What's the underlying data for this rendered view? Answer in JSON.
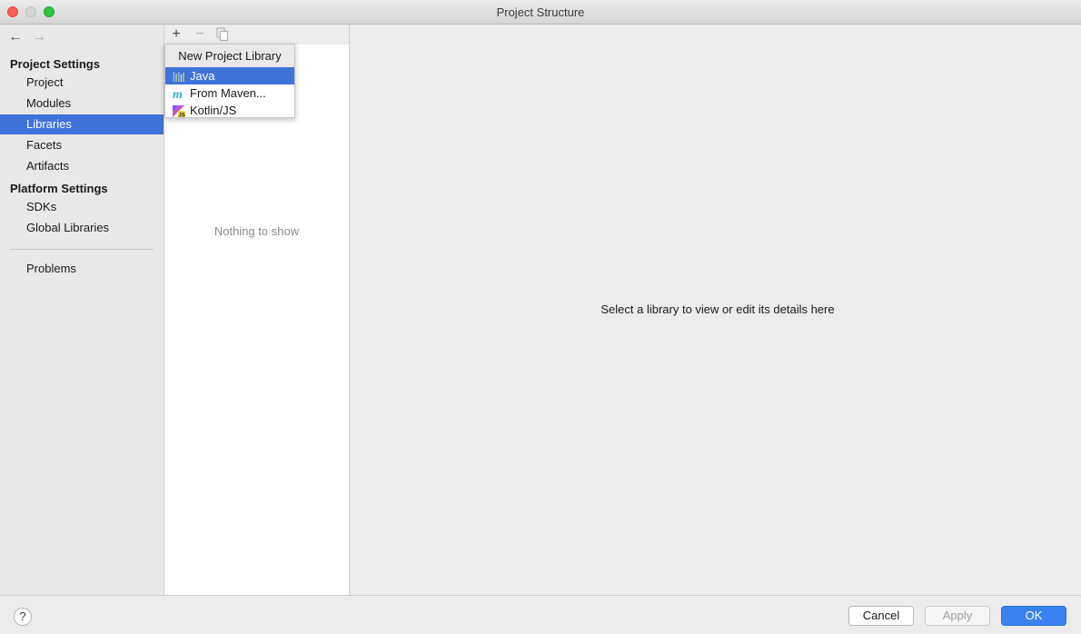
{
  "window": {
    "title": "Project Structure"
  },
  "sidebar": {
    "project_settings_title": "Project Settings",
    "project_items": [
      {
        "label": "Project"
      },
      {
        "label": "Modules"
      },
      {
        "label": "Libraries",
        "selected": true
      },
      {
        "label": "Facets"
      },
      {
        "label": "Artifacts"
      }
    ],
    "platform_settings_title": "Platform Settings",
    "platform_items": [
      {
        "label": "SDKs"
      },
      {
        "label": "Global Libraries"
      }
    ],
    "problems_label": "Problems"
  },
  "library_list": {
    "empty_text": "Nothing to show"
  },
  "popup": {
    "header": "New Project Library",
    "items": [
      {
        "label": "Java",
        "icon": "java-library-icon",
        "active": true
      },
      {
        "label": "From Maven...",
        "icon": "maven-icon"
      },
      {
        "label": "Kotlin/JS",
        "icon": "kotlin-js-icon"
      }
    ]
  },
  "details": {
    "message": "Select a library to view or edit its details here"
  },
  "footer": {
    "help_label": "?",
    "cancel_label": "Cancel",
    "apply_label": "Apply",
    "ok_label": "OK"
  },
  "colors": {
    "accent": "#3f73d8",
    "ok_button": "#3b82f0",
    "close": "#fc5f57",
    "maximize": "#2bc840"
  }
}
